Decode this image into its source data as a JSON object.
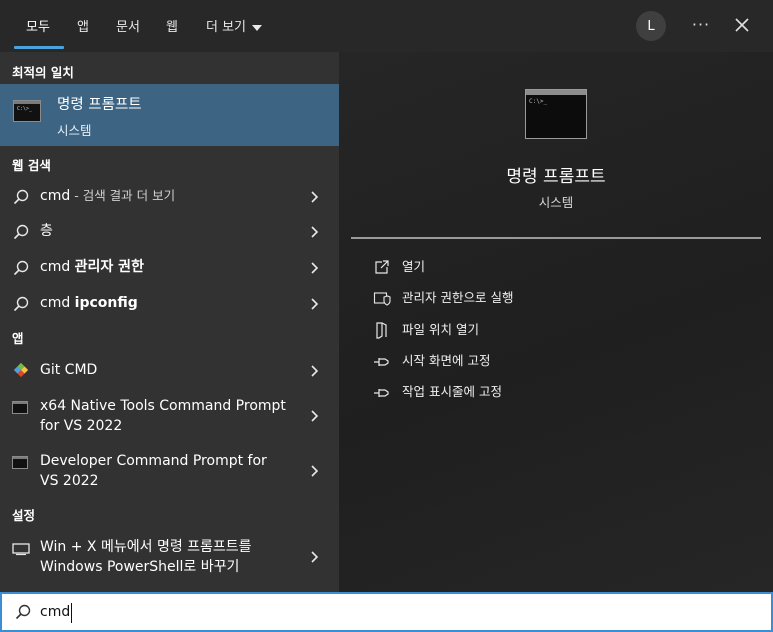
{
  "tabs": [
    {
      "label": "모두"
    },
    {
      "label": "앱"
    },
    {
      "label": "문서"
    },
    {
      "label": "웹"
    },
    {
      "label": "더 보기"
    }
  ],
  "account": {
    "initial": "L"
  },
  "header": {
    "more_options": "···"
  },
  "left": {
    "best_match_header": "최적의 일치",
    "best_match": {
      "title": "명령 프롬프트",
      "subtitle": "시스템",
      "icon": "command-prompt-icon"
    },
    "web_header": "웹 검색",
    "web_results": [
      {
        "query": "cmd",
        "suffix": " - 검색 결과 더 보기"
      },
      {
        "query": "층",
        "suffix": ""
      },
      {
        "query": "cmd ",
        "bold": "관리자 권한"
      },
      {
        "query": "cmd ",
        "bold": "ipconfig"
      }
    ],
    "apps_header": "앱",
    "apps": [
      {
        "line1": "Git CMD",
        "line2": "",
        "icon": "git-cmd-icon"
      },
      {
        "line1": "x64 Native Tools Command Prompt",
        "line2": "for VS 2022",
        "icon": "console-icon"
      },
      {
        "line1": "Developer Command Prompt for",
        "line2": "VS 2022",
        "icon": "console-icon"
      }
    ],
    "settings_header": "설정",
    "settings": [
      {
        "line1": "Win + X 메뉴에서 명령 프롬프트를",
        "line2": "Windows PowerShell로 바꾸기",
        "icon": "monitor-icon"
      }
    ]
  },
  "right": {
    "app_title": "명령 프롬프트",
    "app_subtitle": "시스템",
    "actions": [
      {
        "label": "열기",
        "icon": "open-icon"
      },
      {
        "label": "관리자 권한으로 실행",
        "icon": "shield-icon"
      },
      {
        "label": "파일 위치 열기",
        "icon": "folder-icon"
      },
      {
        "label": "시작 화면에 고정",
        "icon": "pin-icon"
      },
      {
        "label": "작업 표시줄에 고정",
        "icon": "pin-icon"
      }
    ]
  },
  "search": {
    "value": "cmd"
  },
  "colors": {
    "accent": "#4aa3df",
    "selected_row": "#3e6483",
    "search_border": "#3b8ed6"
  }
}
